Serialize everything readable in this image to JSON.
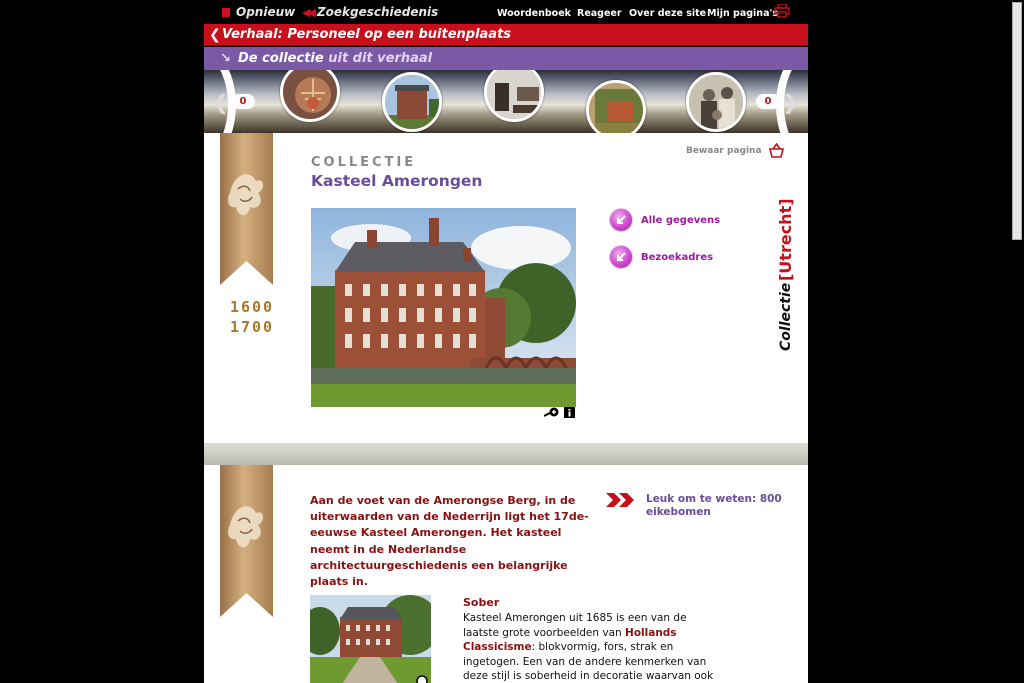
{
  "topnav": {
    "restart": "Opnieuw",
    "history": "Zoekgeschiedenis",
    "links": [
      "Woordenboek",
      "Reageer",
      "Over deze site",
      "Mijn pagina's"
    ]
  },
  "story_bar": {
    "prefix": "Verhaal:",
    "title": " Personeel op een buitenplaats"
  },
  "collection_bar": {
    "main": "De collectie",
    "sub": " uit dit verhaal"
  },
  "carousel": {
    "left_count": "0",
    "right_count": "0",
    "thumb_icons": [
      "chandelier-photo",
      "castle-photo",
      "interior-photo",
      "painting-photo",
      "group-portrait-photo"
    ]
  },
  "header": {
    "save_label": "Bewaar pagina",
    "kicker": "COLLECTIE",
    "title": "Kasteel Amerongen"
  },
  "period": {
    "start": "1600",
    "end": "1700"
  },
  "side_links": [
    "Alle gegevens",
    "Bezoekadres"
  ],
  "brand": {
    "left": "Collectie",
    "right": "Utrecht",
    "color": "#c8101c"
  },
  "intro": {
    "text": "Aan de voet van de Amerongse Berg, in de uiterwaarden van de Nederrijn ligt het 17de-eeuwse Kasteel Amerongen. Het kasteel neemt in de Nederlandse architectuurgeschiedenis een belangrijke plaats in.",
    "fact": "Leuk om te weten: 800 eikebomen"
  },
  "section": {
    "heading": "Sober",
    "body_before": "Kasteel Amerongen uit 1685 is een van de laatste grote voorbeelden van ",
    "body_bold": "Hollands Classicisme",
    "body_after": ": blokvormig, fors, strak en ingetogen. Een van de andere kenmerken van deze stijl is soberheid in decoratie waarvan ook Kasteel Amerongen het"
  },
  "colors": {
    "red": "#c8101c",
    "purple": "#7a5aa6",
    "title_purple": "#6a4d9a",
    "dark_red_text": "#8a1010",
    "gold": "#a9782a",
    "magenta": "#a01aa0"
  }
}
